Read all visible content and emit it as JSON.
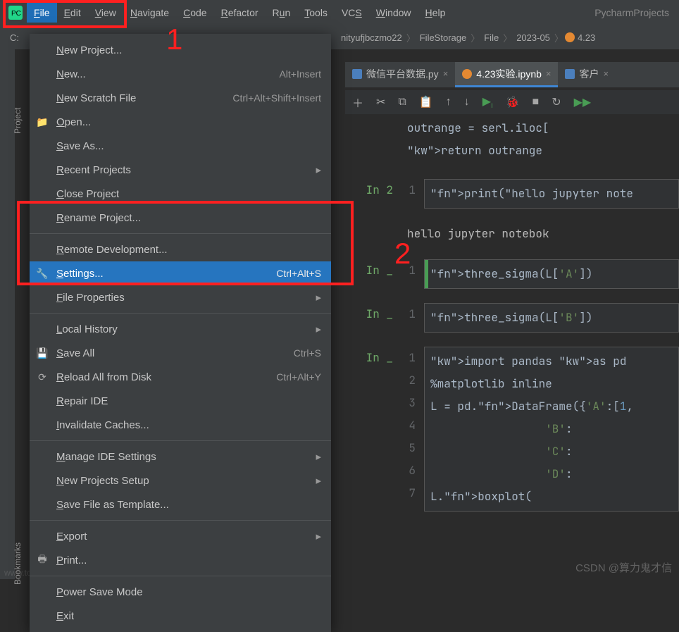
{
  "annotations": {
    "one": "1",
    "two": "2"
  },
  "menubar": {
    "items": [
      "File",
      "Edit",
      "View",
      "Navigate",
      "Code",
      "Refactor",
      "Run",
      "Tools",
      "VCS",
      "Window",
      "Help"
    ],
    "underlines": [
      "F",
      "E",
      "V",
      "N",
      "C",
      "R",
      "u",
      "T",
      "S",
      "W",
      "H"
    ],
    "project": "PycharmProjects"
  },
  "breadcrumb": {
    "drive": "C:",
    "crumbs": [
      "nityufjbczmo22",
      "FileStorage",
      "File",
      "2023-05",
      "4.23"
    ]
  },
  "sidebar": {
    "project": "Project",
    "bookmarks": "Bookmarks"
  },
  "dropdown": {
    "items": [
      {
        "icon": "",
        "label": "New Project...",
        "scut": "",
        "arrow": false
      },
      {
        "icon": "",
        "label": "New...",
        "scut": "Alt+Insert",
        "arrow": false
      },
      {
        "icon": "",
        "label": "New Scratch File",
        "scut": "Ctrl+Alt+Shift+Insert",
        "arrow": false
      },
      {
        "icon": "folder",
        "label": "Open...",
        "scut": "",
        "arrow": false
      },
      {
        "icon": "",
        "label": "Save As...",
        "scut": "",
        "arrow": false
      },
      {
        "icon": "",
        "label": "Recent Projects",
        "scut": "",
        "arrow": true
      },
      {
        "icon": "",
        "label": "Close Project",
        "scut": "",
        "arrow": false
      },
      {
        "icon": "",
        "label": "Rename Project...",
        "scut": "",
        "arrow": false
      },
      {
        "sep": true
      },
      {
        "icon": "",
        "label": "Remote Development...",
        "scut": "",
        "arrow": false
      },
      {
        "icon": "wrench",
        "label": "Settings...",
        "scut": "Ctrl+Alt+S",
        "arrow": false,
        "highlight": true
      },
      {
        "icon": "",
        "label": "File Properties",
        "scut": "",
        "arrow": true
      },
      {
        "sep": true
      },
      {
        "icon": "",
        "label": "Local History",
        "scut": "",
        "arrow": true
      },
      {
        "icon": "save",
        "label": "Save All",
        "scut": "Ctrl+S",
        "arrow": false
      },
      {
        "icon": "reload",
        "label": "Reload All from Disk",
        "scut": "Ctrl+Alt+Y",
        "arrow": false
      },
      {
        "icon": "",
        "label": "Repair IDE",
        "scut": "",
        "arrow": false
      },
      {
        "icon": "",
        "label": "Invalidate Caches...",
        "scut": "",
        "arrow": false
      },
      {
        "sep": true
      },
      {
        "icon": "",
        "label": "Manage IDE Settings",
        "scut": "",
        "arrow": true
      },
      {
        "icon": "",
        "label": "New Projects Setup",
        "scut": "",
        "arrow": true
      },
      {
        "icon": "",
        "label": "Save File as Template...",
        "scut": "",
        "arrow": false
      },
      {
        "sep": true
      },
      {
        "icon": "",
        "label": "Export",
        "scut": "",
        "arrow": true
      },
      {
        "icon": "print",
        "label": "Print...",
        "scut": "",
        "arrow": false
      },
      {
        "sep": true
      },
      {
        "icon": "",
        "label": "Power Save Mode",
        "scut": "",
        "arrow": false
      },
      {
        "icon": "",
        "label": "Exit",
        "scut": "",
        "arrow": false
      }
    ]
  },
  "tabs": [
    {
      "label": "微信平台数据.py",
      "active": false,
      "type": "py"
    },
    {
      "label": "4.23实验.ipynb",
      "active": true,
      "type": "jup"
    },
    {
      "label": "客户",
      "active": false,
      "type": "py"
    }
  ],
  "cells": [
    {
      "prompt": "",
      "lines": [
        "outrange = serl.iloc[",
        "return outrange"
      ],
      "type": "code-plain"
    },
    {
      "prompt": "In 2",
      "lineNums": [
        "1"
      ],
      "lines": [
        "print(\"hello jupyter note"
      ],
      "type": "code-box"
    },
    {
      "prompt": "",
      "output": "hello jupyter notebok",
      "type": "output"
    },
    {
      "prompt": "In _",
      "lineNums": [
        "1"
      ],
      "lines": [
        "three_sigma(L['A'])"
      ],
      "type": "code-box",
      "green": true
    },
    {
      "prompt": "In _",
      "lineNums": [
        "1"
      ],
      "lines": [
        "three_sigma(L['B'])"
      ],
      "type": "code-box"
    },
    {
      "prompt": "In _",
      "lineNums": [
        "1",
        "2",
        "3",
        "4",
        "5",
        "6",
        "7"
      ],
      "lines": [
        "import pandas as pd",
        "%matplotlib inline",
        "L = pd.DataFrame({'A':[1,",
        "                 'B':",
        "                 'C':",
        "                 'D':",
        "L.boxplot("
      ],
      "type": "code-box"
    }
  ],
  "watermark": "CSDN @算力鬼才信",
  "footer": "www.toymoban.com"
}
